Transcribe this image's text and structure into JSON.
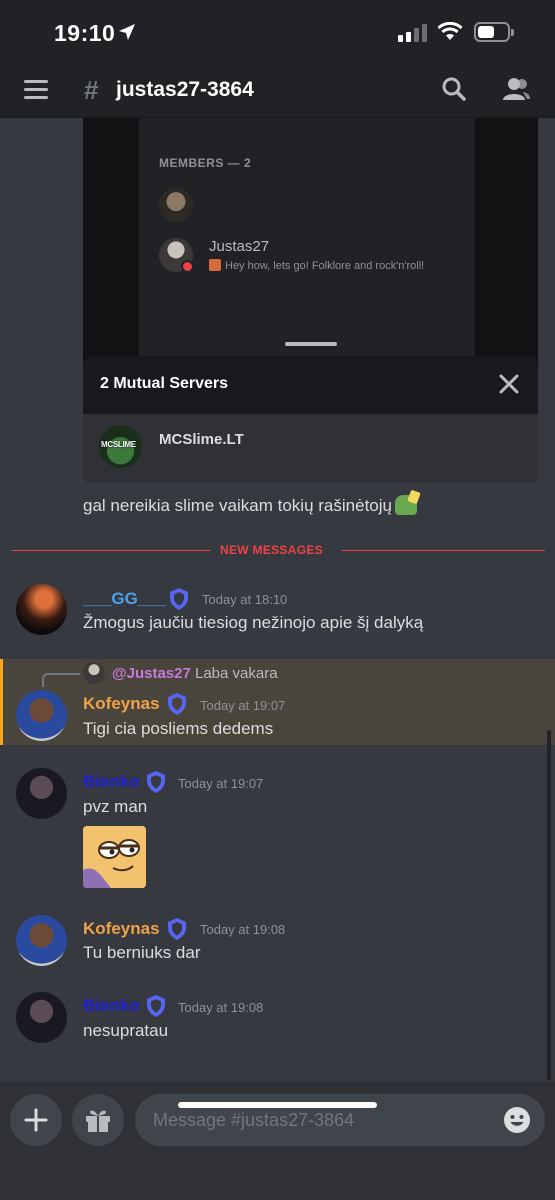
{
  "status_bar": {
    "time": "19:10"
  },
  "header": {
    "channel_name": "justas27-3864"
  },
  "embed": {
    "members_title": "MEMBERS — 2",
    "member_name": "Justas27",
    "member_status": "Hey how, lets go! Folklore and rock'n'roll!",
    "mutual_title": "2 Mutual Servers",
    "server_name": "MCSlime.LT",
    "server_icon_text": "MCSLIME"
  },
  "loose_message": "gal nereikia slime vaikam tokių rašinėtojų",
  "divider": {
    "label": "NEW MESSAGES"
  },
  "messages": [
    {
      "author": "___GG___",
      "author_color": "#4ea1e8",
      "timestamp": "Today at 18:10",
      "text": "Žmogus jaučiu tiesiog nežinojo apie šį dalyką"
    },
    {
      "reply_to": "@Justas27",
      "reply_text": "Laba vakara",
      "author": "Kofeynas",
      "author_color": "#f0a24a",
      "timestamp": "Today at 19:07",
      "text": "Tigi cia posliems dedems"
    },
    {
      "author": "Bienko",
      "author_color": "#1f1fd6",
      "timestamp": "Today at 19:07",
      "text": "pvz man"
    },
    {
      "author": "Kofeynas",
      "author_color": "#f0a24a",
      "timestamp": "Today at 19:08",
      "text": "Tu berniuks dar"
    },
    {
      "author": "Bienko",
      "author_color": "#1f1fd6",
      "timestamp": "Today at 19:08",
      "text": "nesupratau"
    }
  ],
  "composer": {
    "placeholder": "Message #justas27-3864"
  },
  "icons": [
    "location-arrow-icon",
    "signal-icon",
    "wifi-icon",
    "battery-icon",
    "menu-icon",
    "hash-icon",
    "search-icon",
    "members-icon",
    "close-icon",
    "shield-icon",
    "plus-icon",
    "gift-icon",
    "emoji-icon"
  ],
  "colors": {
    "background": "#36393f",
    "header": "#202225",
    "new_messages": "#ed4245",
    "mention_highlight": "#49443c",
    "mention_bar": "#faa61a",
    "shield": "#5865f2"
  }
}
